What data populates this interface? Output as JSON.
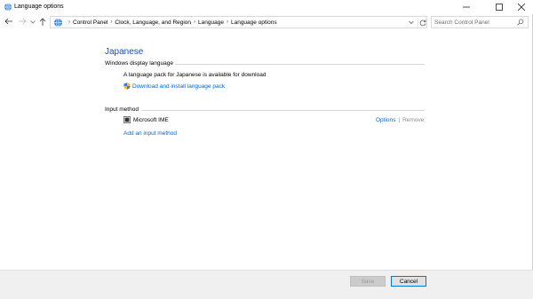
{
  "window": {
    "title": "Language options",
    "controls": {
      "minimize": "minimize-icon",
      "maximize": "maximize-icon",
      "close": "close-icon"
    }
  },
  "nav": {
    "breadcrumb": [
      "Control Panel",
      "Clock, Language, and Region",
      "Language",
      "Language options"
    ],
    "search_placeholder": "Search Control Panel"
  },
  "main": {
    "language_title": "Japanese",
    "display_section": {
      "label": "Windows display language",
      "message": "A language pack for Japanese is available for download",
      "download_link": "Download and install language pack"
    },
    "input_section": {
      "label": "Input method",
      "ime_name": "Microsoft IME",
      "options_label": "Options",
      "separator": "|",
      "remove_label": "Remove",
      "add_link": "Add an input method"
    }
  },
  "footer": {
    "save_label": "Save",
    "cancel_label": "Cancel"
  },
  "colors": {
    "link": "#0066cc",
    "title_blue": "#1e4e9d",
    "footer_bg": "#f0f0f0"
  }
}
